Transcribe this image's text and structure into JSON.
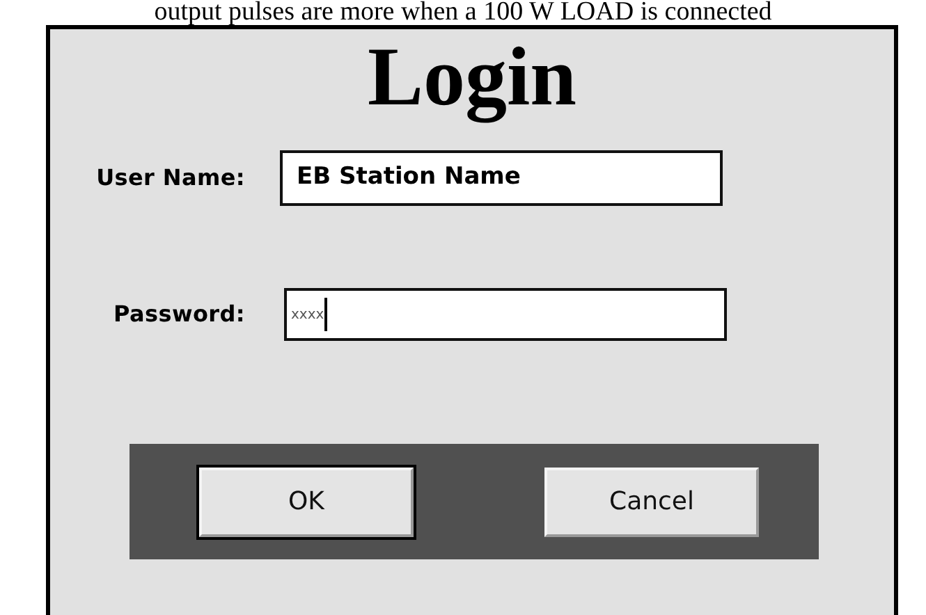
{
  "caption": "output pulses are more when a 100 W LOAD is connected",
  "dialog": {
    "title": "Login",
    "fields": [
      {
        "label": "User Name:",
        "value": "EB Station Name",
        "kind": "text",
        "focused": false
      },
      {
        "label": "Password:",
        "value": "xxxx",
        "kind": "password",
        "focused": true
      }
    ],
    "buttons": [
      {
        "label": "OK",
        "default": true
      },
      {
        "label": "Cancel",
        "default": false
      }
    ]
  }
}
